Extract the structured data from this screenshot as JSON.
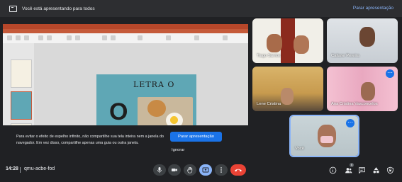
{
  "top_bar": {
    "message": "Você está apresentando para todos",
    "stop_label": "Parar apresentação"
  },
  "slide": {
    "title": "LETRA  O",
    "big_letter": "O"
  },
  "share_warning": {
    "text": "Para evitar o efeito de espelho infinito, não compartilhe sua tela inteira nem a janela do navegador. Em vez disso, compartilhe apenas uma guia ou outra janela.",
    "stop_button": "Parar apresentação",
    "ignore_button": "Ignorar"
  },
  "participants": [
    {
      "name": "Tiago Santos"
    },
    {
      "name": "Cailane Pereira"
    },
    {
      "name": "Lene Cristina"
    },
    {
      "name": "Ana Cristina Vasconcelos"
    },
    {
      "name": "Você"
    }
  ],
  "bottom_bar": {
    "time": "14:28",
    "meeting_code": "qmu-acbe-fod",
    "people_count": "6"
  },
  "colors": {
    "accent": "#8ab4f8",
    "primary_button": "#1a73e8",
    "hangup": "#ea4335",
    "background": "#202124"
  }
}
